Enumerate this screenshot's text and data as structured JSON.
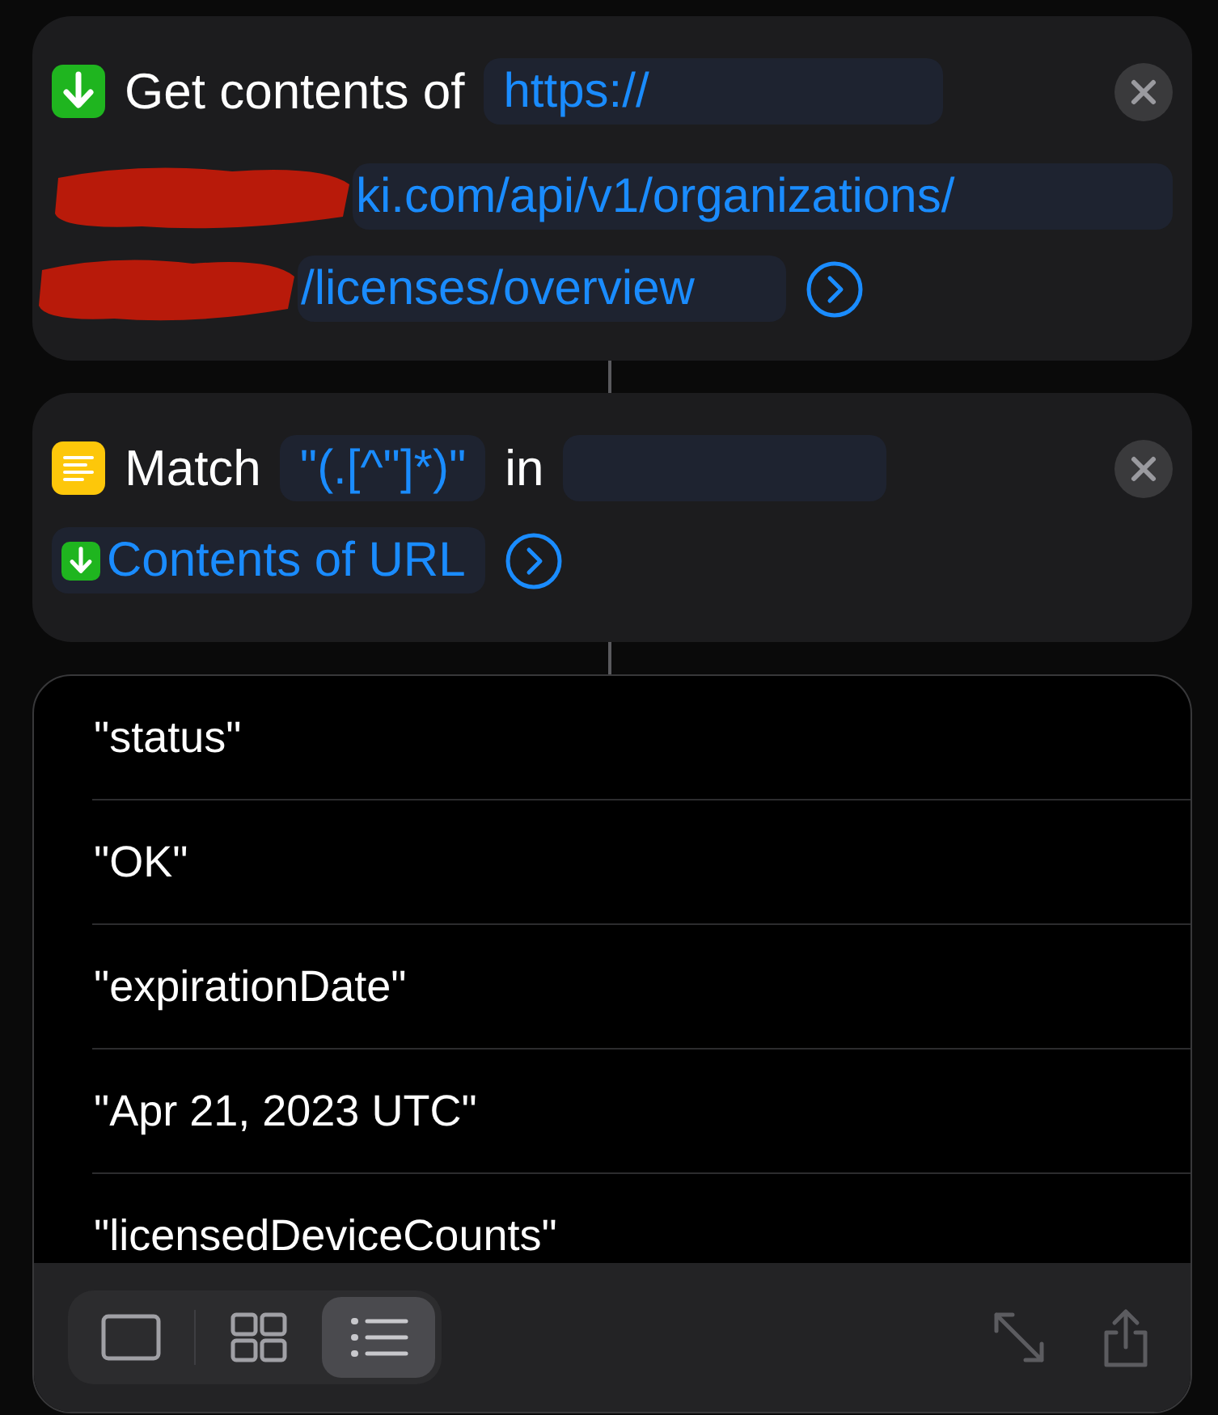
{
  "get_contents": {
    "title": "Get contents of",
    "url_lines": [
      "https://",
      "ki.com/api/v1/organizations/",
      "/licenses/overview"
    ]
  },
  "match": {
    "title": "Match",
    "pattern": "\"(.[^\"]*)\"",
    "connector": "in",
    "input": "Contents of URL"
  },
  "results": [
    "\"status\"",
    "\"OK\"",
    "\"expirationDate\"",
    "\"Apr 21, 2023 UTC\"",
    "\"licensedDeviceCounts\""
  ],
  "toolbar": {
    "views": [
      {
        "kind": "single",
        "selected": false
      },
      {
        "kind": "grid",
        "selected": false
      },
      {
        "kind": "list",
        "selected": true
      }
    ]
  }
}
